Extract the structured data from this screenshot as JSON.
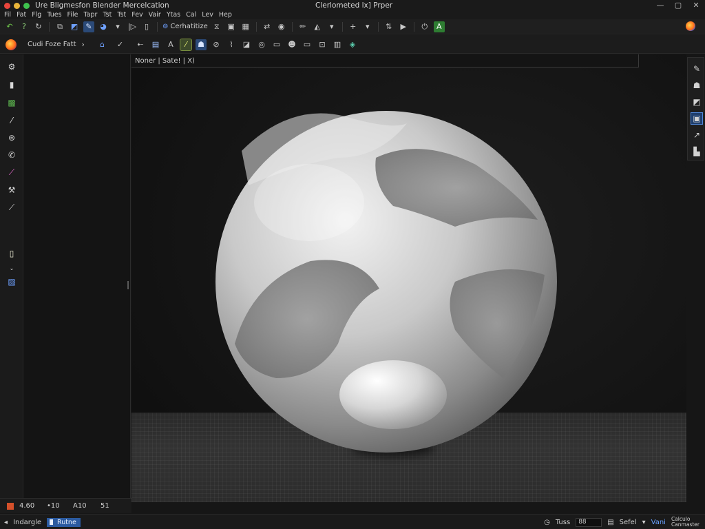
{
  "window": {
    "app_title": "Ure Bligmesfon Blender Mercelcation",
    "doc_title": "Clerlometed lx] Prper",
    "controls": [
      "—",
      "▢",
      "✕"
    ]
  },
  "menu": [
    "Fil",
    "Fat",
    "Flg",
    "Tues",
    "File",
    "Tapr",
    "Tst",
    "Tst",
    "Fev",
    "Vair",
    "Ytas",
    "Cal",
    "Lev",
    "Hep"
  ],
  "toolbar1": {
    "text_button": "Cerhatitize",
    "accent": "#2e7d32"
  },
  "toolbar2": {
    "left_label": "Cudi Foze Fatt",
    "left_arrow": "›"
  },
  "viewport": {
    "header": "Noner | Sate! |  X)"
  },
  "timeline": {
    "cells": [
      "4.60",
      "•10",
      "A10",
      "51"
    ]
  },
  "statusbar": {
    "left_label": "Indargle",
    "mode_button": "Rutne",
    "right_label1": "Tuss",
    "right_field": "88",
    "right_label2": "Sefel",
    "right_link": "Vani",
    "right_stack_1": "Calculo",
    "right_stack_2": "Canmaster"
  },
  "icons": {
    "left_strip": [
      "gear-icon",
      "page-icon",
      "swatch-icon",
      "brush-icon",
      "gauge-icon",
      "phone-icon",
      "paint-tube-icon",
      "hammer-icon",
      "eyedropper-icon",
      "file-icon",
      "image-icon"
    ],
    "right_strip": [
      "pencil-icon",
      "person-icon",
      "eraser-icon",
      "frame-icon",
      "arrow-icon",
      "bucket-icon"
    ]
  }
}
